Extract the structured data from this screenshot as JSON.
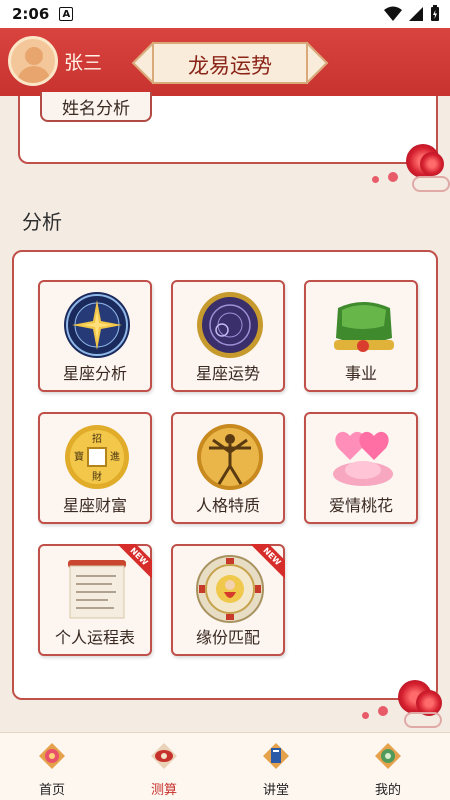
{
  "status_bar": {
    "time": "2:06",
    "notification_icon": "A"
  },
  "header": {
    "username": "张三",
    "title": "龙易运势"
  },
  "top_card": {
    "item_label": "姓名分析"
  },
  "section": {
    "title": "分析"
  },
  "grid": {
    "items": [
      {
        "label": "星座分析",
        "icon": "zodiac-wheel-icon"
      },
      {
        "label": "星座运势",
        "icon": "astrology-dial-icon"
      },
      {
        "label": "事业",
        "icon": "official-hat-icon"
      },
      {
        "label": "星座财富",
        "icon": "coin-icon",
        "coin_chars": [
          "招",
          "進",
          "財",
          "寶"
        ]
      },
      {
        "label": "人格特质",
        "icon": "vitruvian-man-icon"
      },
      {
        "label": "爱情桃花",
        "icon": "hearts-lotus-icon"
      },
      {
        "label": "个人运程表",
        "icon": "scroll-document-icon",
        "badge": "NEW"
      },
      {
        "label": "缘份匹配",
        "icon": "bagua-compass-icon",
        "badge": "NEW"
      }
    ]
  },
  "bottom_nav": {
    "items": [
      {
        "label": "首页",
        "icon": "lotus-home-icon"
      },
      {
        "label": "测算",
        "icon": "divination-icon",
        "active": true
      },
      {
        "label": "讲堂",
        "icon": "book-lecture-icon"
      },
      {
        "label": "我的",
        "icon": "profile-medallion-icon"
      }
    ]
  },
  "colors": {
    "header_red": "#c8322f",
    "border_red": "#c0504a",
    "page_bg": "#f4ece3",
    "active_nav": "#c7312c"
  }
}
